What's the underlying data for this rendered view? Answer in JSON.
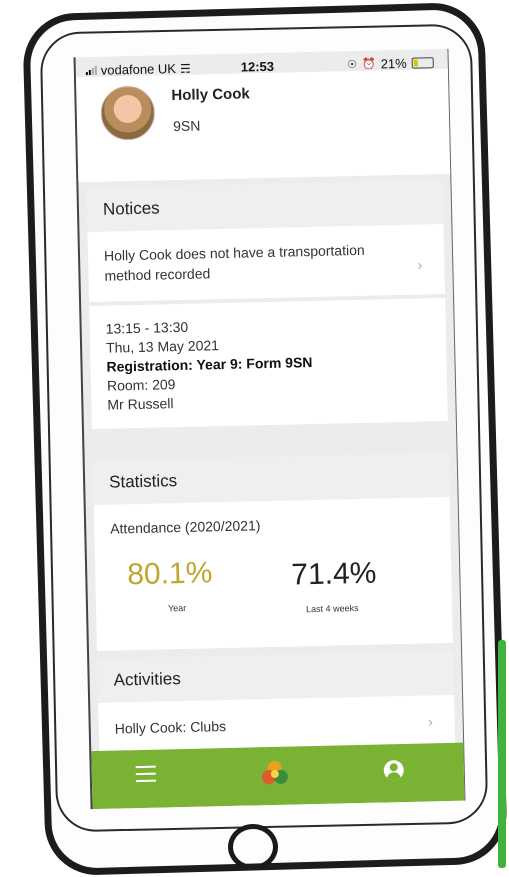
{
  "status_bar": {
    "carrier": "vodafone UK",
    "time": "12:53",
    "battery": "21%",
    "battery_level": 0.21
  },
  "profile": {
    "name": "Holly Cook",
    "form": "9SN"
  },
  "notices": {
    "header": "Notices",
    "notice_text": "Holly Cook does not have a transportation method recorded",
    "event": {
      "time": "13:15 - 13:30",
      "date": "Thu, 13 May 2021",
      "title": "Registration: Year 9: Form 9SN",
      "room": "Room: 209",
      "teacher": "Mr Russell"
    }
  },
  "statistics": {
    "header": "Statistics",
    "attendance_label": "Attendance (2020/2021)",
    "year_value": "80.1%",
    "year_label": "Year",
    "last4_value": "71.4%",
    "last4_label": "Last 4 weeks"
  },
  "activities": {
    "header": "Activities",
    "item": "Holly Cook: Clubs"
  },
  "tab_bar": {
    "menu_icon": "menu-icon",
    "logo_icon": "app-logo-icon",
    "profile_icon": "user-icon"
  },
  "colors": {
    "accent_green": "#7ab334",
    "year_stat": "#c2a530",
    "battery": "#d9c400"
  }
}
